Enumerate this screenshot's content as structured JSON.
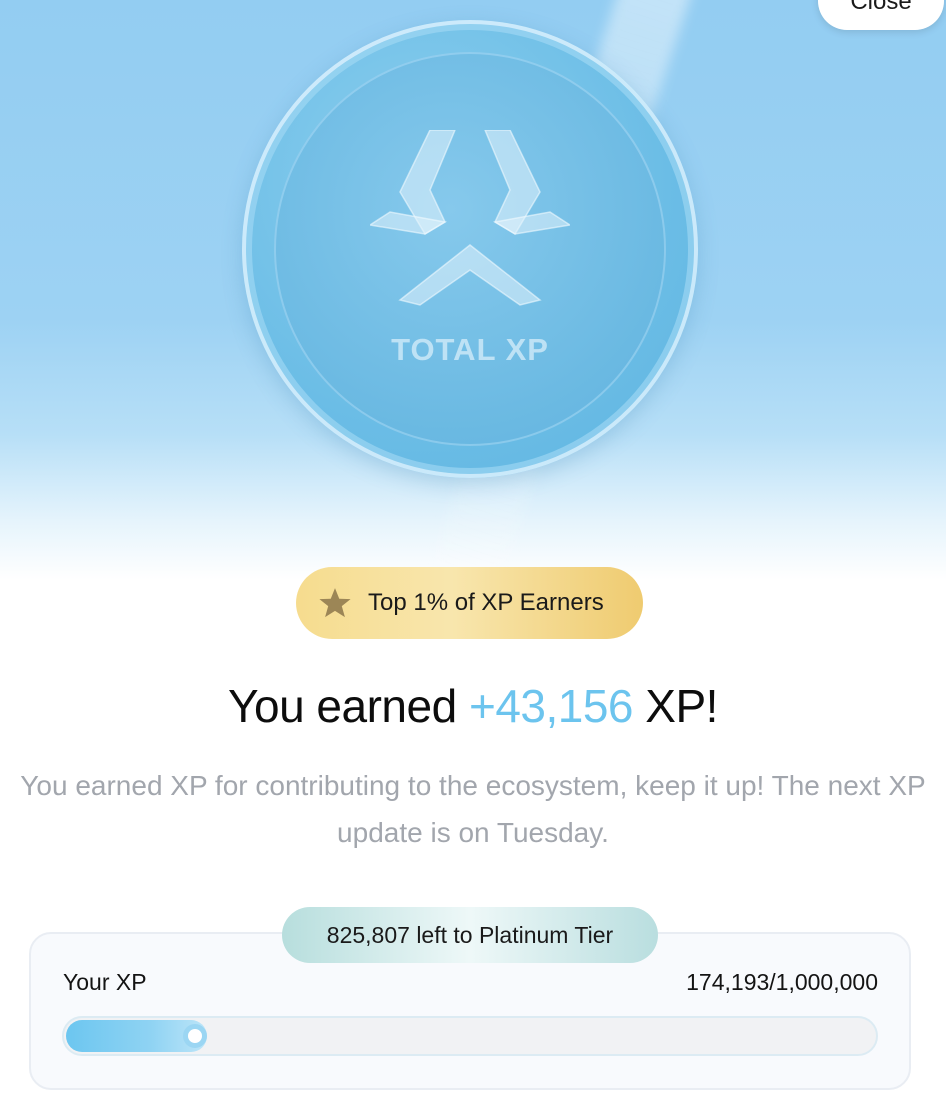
{
  "header": {
    "close_label": "Close"
  },
  "coin": {
    "label": "TOTAL XP",
    "logo_icon": "xp-logo-icon"
  },
  "badge": {
    "icon": "star-icon",
    "text": "Top 1% of XP Earners"
  },
  "headline": {
    "prefix": "You earned ",
    "amount": "+43,156",
    "suffix": " XP!"
  },
  "description": "You earned XP for contributing to the ecosystem, keep it up! The next XP update is on Tuesday.",
  "progress": {
    "tier_message": "825,807 left to Platinum Tier",
    "label": "Your XP",
    "value_text": "174,193/1,000,000",
    "current": 174193,
    "max": 1000000,
    "fraction": 0.174193
  },
  "colors": {
    "accent": "#6cc4ee",
    "badge_gold": "#f3d77f",
    "hero_blue": "#93cdf2"
  }
}
